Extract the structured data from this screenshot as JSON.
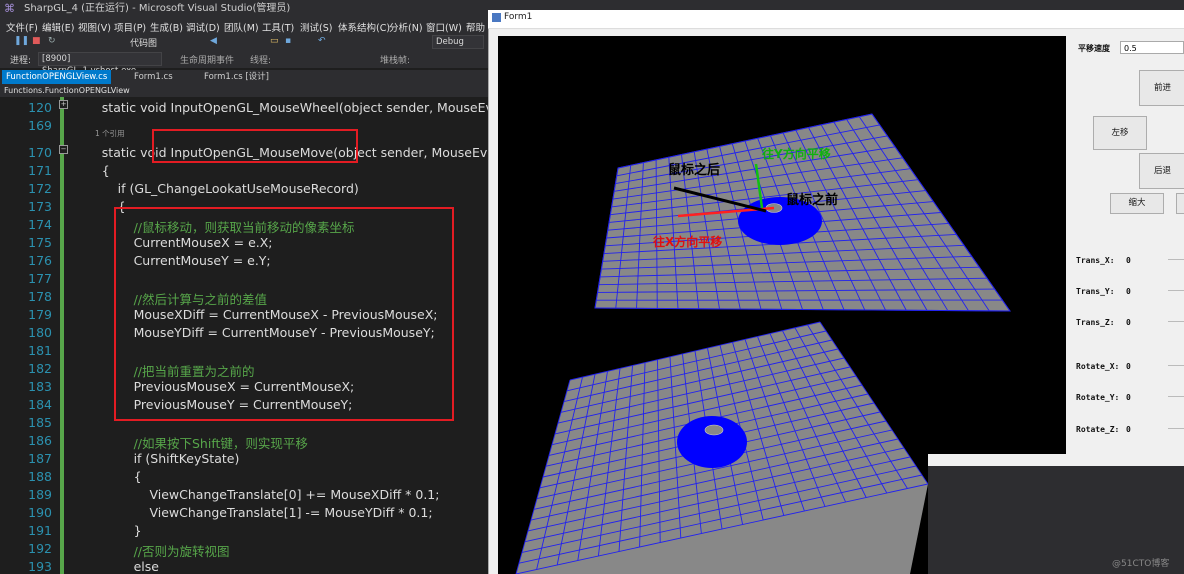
{
  "vs": {
    "title": "SharpGL_4 (正在运行) - Microsoft Visual Studio(管理员)",
    "menu": [
      "文件(F)",
      "编辑(E)",
      "视图(V)",
      "项目(P)",
      "生成(B)",
      "调试(D)",
      "团队(M)",
      "工具(T)",
      "测试(S)",
      "体系结构(C)",
      "分析(N)",
      "窗口(W)",
      "帮助"
    ],
    "toolbar_code_view": "代码图",
    "process_label": "进程:",
    "process_value": "[8900] SharpGL_1.vshost.exe",
    "debug_mode": "Debug",
    "lifecycle": "生命周期事件",
    "thread": "线程:",
    "stack": "堆栈帧:",
    "tabs": [
      "FunctionOPENGLView.cs",
      "Form1.cs",
      "Form1.cs [设计]"
    ],
    "nav": "Functions.FunctionOPENGLView",
    "ref_count": "1 个引用"
  },
  "code_lines": [
    {
      "n": "120",
      "t": "        static void InputOpenGL_MouseWheel(object sender, MouseEve"
    },
    {
      "n": "169",
      "t": ""
    },
    {
      "n": "170",
      "t": "        static void InputOpenGL_MouseMove(object sender, MouseEve"
    },
    {
      "n": "171",
      "t": "        {"
    },
    {
      "n": "172",
      "t": "            if (GL_ChangeLookatUseMouseRecord)"
    },
    {
      "n": "173",
      "t": "            {"
    },
    {
      "n": "174",
      "t": "                //鼠标移动，则获取当前移动的像素坐标"
    },
    {
      "n": "175",
      "t": "                CurrentMouseX = e.X;"
    },
    {
      "n": "176",
      "t": "                CurrentMouseY = e.Y;"
    },
    {
      "n": "177",
      "t": ""
    },
    {
      "n": "178",
      "t": "                //然后计算与之前的差值"
    },
    {
      "n": "179",
      "t": "                MouseXDiff = CurrentMouseX - PreviousMouseX;"
    },
    {
      "n": "180",
      "t": "                MouseYDiff = CurrentMouseY - PreviousMouseY;"
    },
    {
      "n": "181",
      "t": ""
    },
    {
      "n": "182",
      "t": "                //把当前重置为之前的"
    },
    {
      "n": "183",
      "t": "                PreviousMouseX = CurrentMouseX;"
    },
    {
      "n": "184",
      "t": "                PreviousMouseY = CurrentMouseY;"
    },
    {
      "n": "185",
      "t": ""
    },
    {
      "n": "186",
      "t": "                //如果按下Shift键，则实现平移"
    },
    {
      "n": "187",
      "t": "                if (ShiftKeyState)"
    },
    {
      "n": "188",
      "t": "                {"
    },
    {
      "n": "189",
      "t": "                    ViewChangeTranslate[0] += MouseXDiff * 0.1;"
    },
    {
      "n": "190",
      "t": "                    ViewChangeTranslate[1] -= MouseYDiff * 0.1;"
    },
    {
      "n": "191",
      "t": "                }"
    },
    {
      "n": "192",
      "t": "                //否则为旋转视图"
    },
    {
      "n": "193",
      "t": "                else"
    }
  ],
  "form": {
    "title": "Form1",
    "speed_label": "平移速度",
    "speed_value": "0.5",
    "btn_forward": "前进",
    "btn_left": "左移",
    "btn_back": "后退",
    "btn_zoom_in": "缩大",
    "labels": [
      {
        "name": "Trans_X:",
        "value": "0"
      },
      {
        "name": "Trans_Y:",
        "value": "0"
      },
      {
        "name": "Trans_Z:",
        "value": "0"
      },
      {
        "name": "Rotate_X:",
        "value": "0"
      },
      {
        "name": "Rotate_Y:",
        "value": "0"
      },
      {
        "name": "Rotate_Z:",
        "value": "0"
      }
    ],
    "annot_after": "鼠标之后",
    "annot_before": "鼠标之前",
    "annot_xdir": "往X方向平移",
    "annot_ydir": "往Y方向平移"
  },
  "watermark": "@51CTO博客",
  "colors": {
    "vs_bg": "#1e1e1e",
    "accent": "#007acc",
    "highlight": "#e31c23",
    "grid_line": "#2222ee",
    "plane": "#888888",
    "disk": "#0000ff"
  }
}
